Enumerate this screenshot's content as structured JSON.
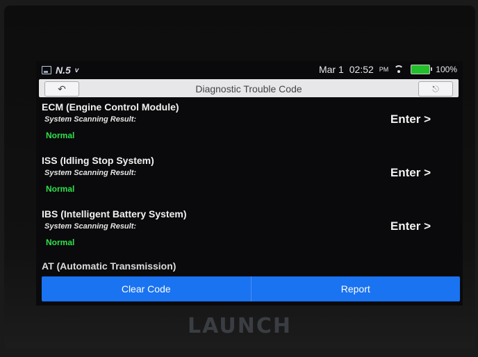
{
  "status": {
    "app_logo": "N.5",
    "app_suffix": "v",
    "date": "Mar 1",
    "time": "02:52",
    "ampm": "PM",
    "battery": "100%"
  },
  "header": {
    "title": "Diagnostic Trouble Code",
    "back_icon": "back-arrow-icon",
    "exit_icon": "exit-icon"
  },
  "systems": [
    {
      "name": "ECM (Engine Control Module)",
      "sub": "System Scanning Result:",
      "status": "Normal",
      "action": "Enter >"
    },
    {
      "name": "ISS (Idling Stop System)",
      "sub": "System Scanning Result:",
      "status": "Normal",
      "action": "Enter >"
    },
    {
      "name": "IBS (Intelligent Battery System)",
      "sub": "System Scanning Result:",
      "status": "Normal",
      "action": "Enter >"
    },
    {
      "name": "AT (Automatic Transmission)"
    }
  ],
  "footer": {
    "clear_label": "Clear Code",
    "report_label": "Report"
  },
  "device": {
    "brand": "LAUNCH"
  },
  "colors": {
    "accent": "#1a73f0",
    "status_normal": "#2fe04a",
    "battery": "#22c02a"
  }
}
